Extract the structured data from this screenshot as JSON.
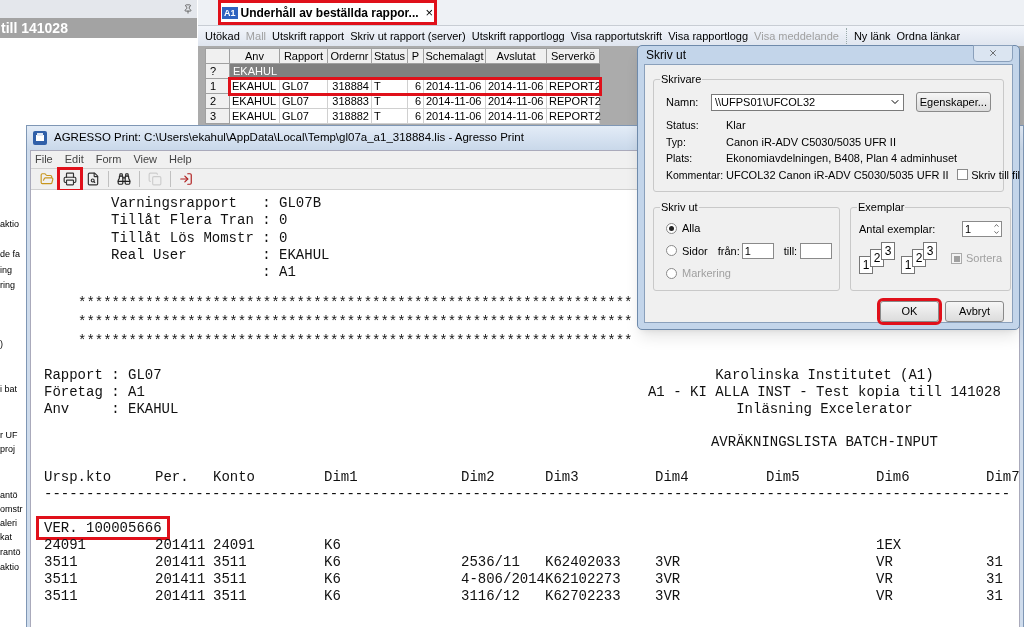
{
  "side_panel": {
    "title": "till 141028",
    "items": [
      "aktio",
      "de fa",
      "ing",
      "ring",
      ")",
      "i bat",
      "r UF",
      "proj",
      "antö",
      "omstr",
      "aleri",
      "kat",
      "rantö",
      "aktio"
    ]
  },
  "report_list": {
    "tab": {
      "badge": "A1",
      "title": "Underhåll av beställda rappor...",
      "close": "×",
      "annotated": true
    },
    "toolbar_groups": [
      [
        {
          "label": "Utökad",
          "disabled": false
        },
        {
          "label": "Mall",
          "disabled": true
        },
        {
          "label": "Utskrift rapport",
          "disabled": false
        },
        {
          "label": "Skriv ut rapport (server)",
          "disabled": false
        },
        {
          "label": "Utskrift rapportlogg",
          "disabled": false
        },
        {
          "label": "Visa rapportutskrift",
          "disabled": false
        },
        {
          "label": "Visa rapportlogg",
          "disabled": false
        },
        {
          "label": "Visa meddelande",
          "disabled": true
        }
      ],
      [
        {
          "label": "Ny länk",
          "disabled": false
        },
        {
          "label": "Ordna länkar",
          "disabled": false
        }
      ]
    ],
    "table": {
      "columns": [
        "Anv",
        "Rapport",
        "Ordernr",
        "Status",
        "P",
        "Schemalagt",
        "Avslutat",
        "Serverkö"
      ],
      "filter_row": {
        "marker": "?",
        "value": "EKAHUL"
      },
      "rows": [
        {
          "number": "1",
          "cells": [
            "EKAHUL",
            "GL07",
            "318884",
            "T",
            "6",
            "2014-11-06",
            "2014-11-06",
            "REPORT2"
          ],
          "annotated": true
        },
        {
          "number": "2",
          "cells": [
            "EKAHUL",
            "GL07",
            "318883",
            "T",
            "6",
            "2014-11-06",
            "2014-11-06",
            "REPORT2"
          ],
          "annotated": false
        },
        {
          "number": "3",
          "cells": [
            "EKAHUL",
            "GL07",
            "318882",
            "T",
            "6",
            "2014-11-06",
            "2014-11-06",
            "REPORT2"
          ],
          "annotated": false
        }
      ]
    }
  },
  "print_window": {
    "title": "AGRESSO Print: C:\\Users\\ekahul\\AppData\\Local\\Temp\\gl07a_a1_318884.lis - Agresso Print",
    "menu": [
      "File",
      "Edit",
      "Form",
      "View",
      "Help"
    ],
    "toolbar": [
      {
        "kind": "open",
        "disabled": false,
        "annotated": false
      },
      {
        "kind": "print",
        "disabled": false,
        "annotated": true
      },
      {
        "kind": "preview",
        "disabled": false,
        "annotated": false
      },
      {
        "kind": "find",
        "disabled": false,
        "annotated": false
      },
      {
        "kind": "copy",
        "disabled": true,
        "annotated": false
      },
      {
        "kind": "export",
        "disabled": false,
        "annotated": false
      }
    ],
    "report": {
      "settings": [
        "Varningsrapport   : GL07B",
        "Tillåt Flera Tran : 0",
        "Tillåt Lös Momstr : 0",
        "Real User         : EKAHUL",
        "                  : A1"
      ],
      "stars": [
        "******************************************************************",
        "******************************************************************",
        "******************************************************************"
      ],
      "header_left": [
        "Rapport : GL07",
        "Företag : A1",
        "Anv     : EKAHUL"
      ],
      "header_right": [
        "Karolinska Institutet (A1)",
        "A1 - KI ALLA INST - Test kopia till 141028",
        "Inläsning Excelerator"
      ],
      "title": "AVRÄKNINGSLISTA BATCH-INPUT",
      "columns": [
        "Ursp.kto",
        "Per.",
        "Konto",
        "Dim1",
        "Dim2",
        "Dim3",
        "Dim4",
        "Dim5",
        "Dim6",
        "Dim7"
      ],
      "rule": "-------------------------------------------------------------------------------------------------------------------",
      "voucher": {
        "text": "VER. 100005666",
        "annotated": true
      },
      "rows": [
        {
          "ursp_kto": "24091",
          "per": "201411",
          "konto": "24091",
          "dim1": "K6",
          "dim6": "1EX"
        },
        {
          "ursp_kto": "3511",
          "per": "201411",
          "konto": "3511",
          "dim1": "K6",
          "dim2": "2536/11",
          "dim3": "K62402033",
          "dim4": "3VR",
          "dim6": "VR",
          "dim7": "31"
        },
        {
          "ursp_kto": "3511",
          "per": "201411",
          "konto": "3511",
          "dim1": "K6",
          "dim2": "4-806/2014",
          "dim3": "K62102273",
          "dim4": "3VR",
          "dim6": "VR",
          "dim7": "31"
        },
        {
          "ursp_kto": "3511",
          "per": "201411",
          "konto": "3511",
          "dim1": "K6",
          "dim2": "3116/12",
          "dim3": "K62702233",
          "dim4": "3VR",
          "dim6": "VR",
          "dim7": "31"
        }
      ]
    }
  },
  "print_dialog": {
    "title": "Skriv ut",
    "printer": {
      "legend": "Skrivare",
      "name_label": "Namn:",
      "name": "\\\\UFPS01\\UFCOL32",
      "properties": "Egenskaper...",
      "info": [
        {
          "label": "Status:",
          "value": "Klar"
        },
        {
          "label": "Typ:",
          "value": "Canon iR-ADV C5030/5035 UFR II"
        },
        {
          "label": "Plats:",
          "value": "Ekonomiavdelningen, B408, Plan 4 adminhuset"
        },
        {
          "label": "Kommentar:",
          "value": "UFCOL32 Canon iR-ADV C5030/5035 UFR II"
        }
      ],
      "print_to_file": {
        "label": "Skriv till fil",
        "checked": false
      }
    },
    "range": {
      "legend": "Skriv ut",
      "options": [
        {
          "kind": "all",
          "label": "Alla",
          "selected": true,
          "disabled": false
        },
        {
          "kind": "pages",
          "label": "Sidor",
          "selected": false,
          "disabled": false
        },
        {
          "kind": "selection",
          "label": "Markering",
          "selected": false,
          "disabled": true
        }
      ],
      "from_label": "från:",
      "from": "1",
      "to_label": "till:"
    },
    "copies": {
      "legend": "Exemplar",
      "count_label": "Antal exemplar:",
      "count": "1",
      "collate_sets": [
        [
          "1",
          "2",
          "3"
        ],
        [
          "1",
          "2",
          "3"
        ]
      ],
      "collate": {
        "label": "Sortera",
        "checked": true,
        "disabled": true
      }
    },
    "buttons": [
      {
        "label": "OK",
        "annotated": true
      },
      {
        "label": "Avbryt",
        "annotated": false
      }
    ]
  }
}
